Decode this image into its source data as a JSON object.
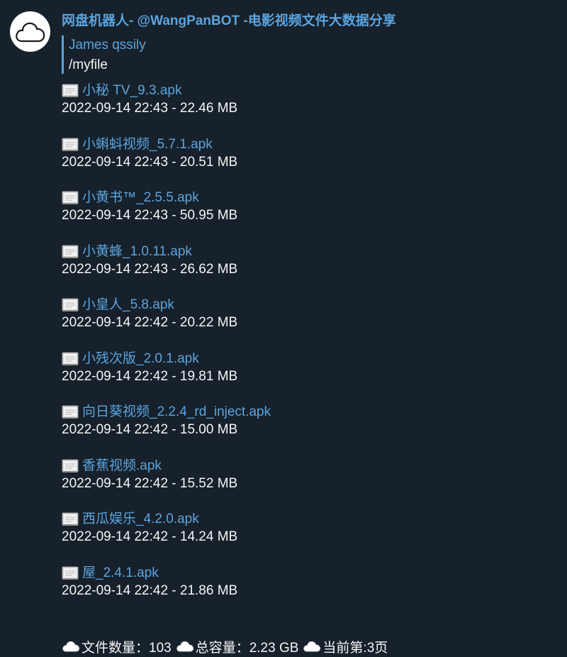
{
  "sender": "网盘机器人- @WangPanBOT -电影视频文件大数据分享",
  "reply": {
    "name": "James qssily",
    "text": "/myfile"
  },
  "files": [
    {
      "name": "小秘 TV_9.3.apk",
      "meta": "2022-09-14 22:43 - 22.46 MB"
    },
    {
      "name": "小蝌蚪视频_5.7.1.apk",
      "meta": "2022-09-14 22:43 - 20.51 MB"
    },
    {
      "name": "小黄书™_2.5.5.apk",
      "meta": "2022-09-14 22:43 - 50.95 MB"
    },
    {
      "name": "小黄蜂_1.0.11.apk",
      "meta": "2022-09-14 22:43 - 26.62 MB"
    },
    {
      "name": "小皇人_5.8.apk",
      "meta": "2022-09-14 22:42 - 20.22 MB"
    },
    {
      "name": "小残次版_2.0.1.apk",
      "meta": "2022-09-14 22:42 - 19.81 MB"
    },
    {
      "name": "向日葵视频_2.2.4_rd_inject.apk",
      "meta": "2022-09-14 22:42 - 15.00 MB"
    },
    {
      "name": "香蕉视频.apk",
      "meta": "2022-09-14 22:42 - 15.52 MB"
    },
    {
      "name": "西瓜娱乐_4.2.0.apk",
      "meta": "2022-09-14 22:42 - 14.24 MB"
    },
    {
      "name": "屋_2.4.1.apk",
      "meta": "2022-09-14 22:42 - 21.86 MB"
    }
  ],
  "footer": {
    "file_count": "文件数量：103",
    "total_size": "总容量：2.23 GB",
    "current_page": "当前第:3页"
  },
  "icons": {
    "avatar": "cloud-icon",
    "file": "document-icon",
    "stat": "cloud-icon"
  },
  "colors": {
    "background": "#17212b",
    "link": "#5ba4de",
    "text": "#f5f5f5"
  }
}
